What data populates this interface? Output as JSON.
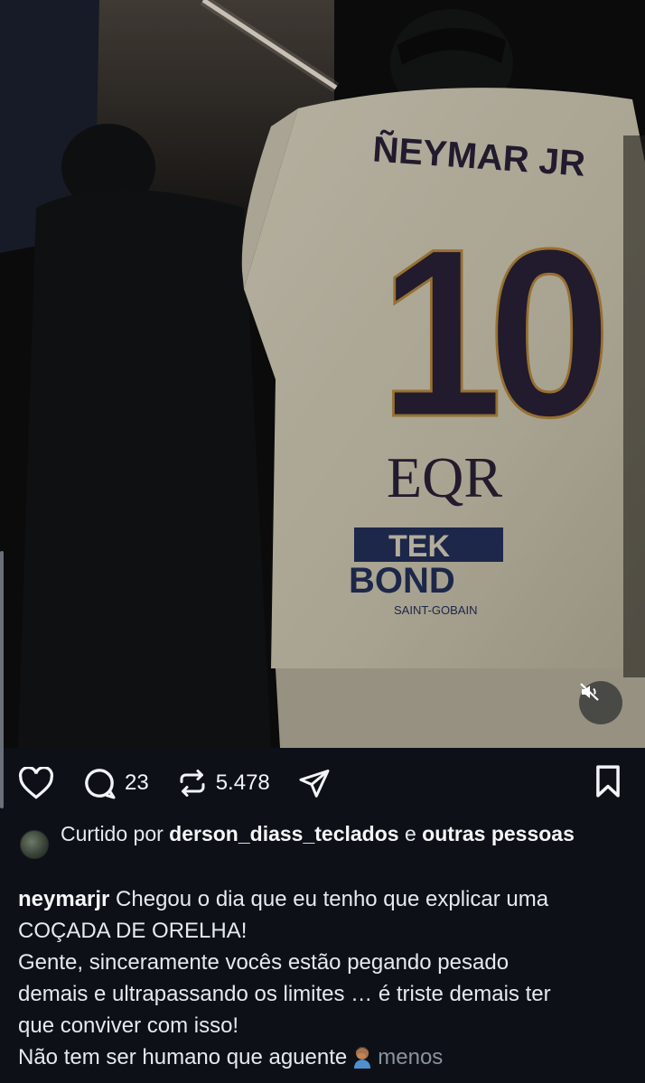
{
  "post": {
    "media": {
      "jersey_name": "ÑEYMAR JR",
      "jersey_number": "10",
      "sponsor_1": "EQR",
      "sponsor_2_top": "TEK",
      "sponsor_2_bottom": "BOND",
      "sponsor_2_sub": "SAINT-GOBAIN",
      "muted": true
    },
    "actions": {
      "like_icon": "heart-icon",
      "comment_icon": "comment-icon",
      "comment_count": "23",
      "repost_icon": "repost-icon",
      "repost_count": "5.478",
      "share_icon": "share-icon",
      "save_icon": "bookmark-icon"
    },
    "liked_by": {
      "prefix": "Curtido por ",
      "user": "derson_diass_teclados",
      "connector": " e ",
      "rest": "outras pessoas"
    },
    "caption": {
      "username": "neymarjr",
      "lines": [
        " Chegou o dia que eu tenho que explicar uma",
        "COÇADA DE ORELHA!",
        "Gente, sinceramente vocês estão pegando pesado",
        "demais e ultrapassando os limites … é triste demais ter",
        "que conviver com isso!",
        "Não tem ser humano que aguente"
      ],
      "emoji": "🤦🏽‍♂️",
      "more_label": "menos"
    }
  },
  "colors": {
    "background": "#0d1117",
    "text": "#e6e9ee",
    "muted_text": "#8b929c",
    "jersey": "#d9d3bf",
    "jersey_number": "#2a2038"
  }
}
